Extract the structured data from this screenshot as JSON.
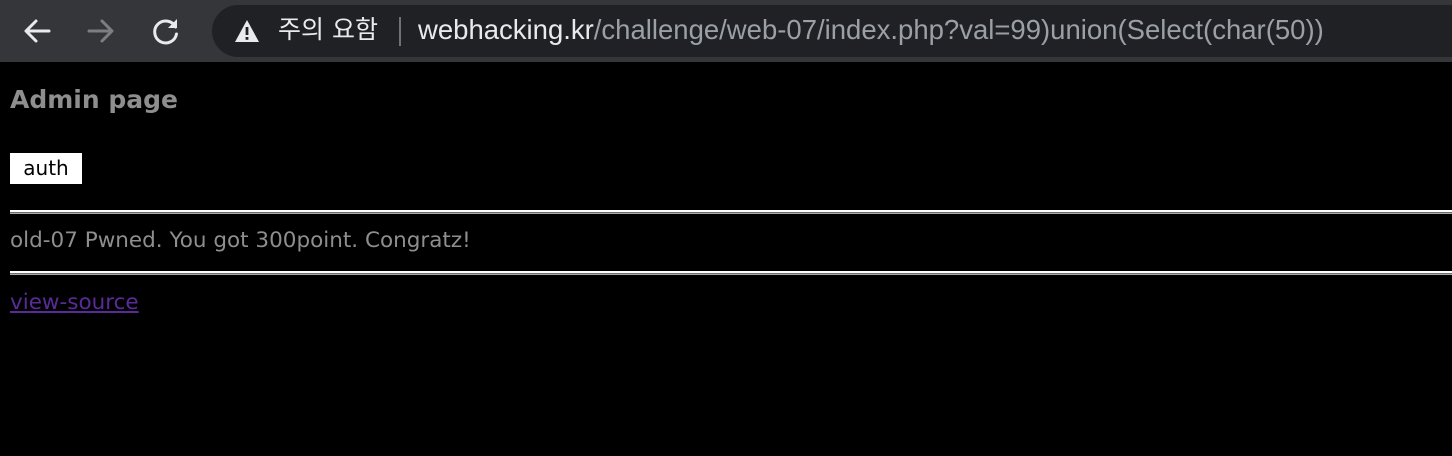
{
  "browser": {
    "security_label": "주의 요함",
    "url_host": "webhacking.kr",
    "url_path": "/challenge/web-07/index.php?val=99)union(Select(char(50))",
    "icons": {
      "back": "arrow-left-icon",
      "forward": "arrow-right-icon",
      "reload": "reload-icon",
      "warning": "warning-triangle-icon"
    },
    "colors": {
      "toolbar": "#35363a",
      "omnibox": "#202124",
      "host_text": "#e8eaed",
      "path_text": "#9aa0a6"
    }
  },
  "page": {
    "title": "Admin page",
    "auth_button_label": "auth",
    "result_message": "old-07 Pwned. You got 300point. Congratz!",
    "view_source_link": "view-source",
    "colors": {
      "background": "#000000",
      "text": "#8e8e8e",
      "link_visited": "#5a2a9a"
    }
  }
}
